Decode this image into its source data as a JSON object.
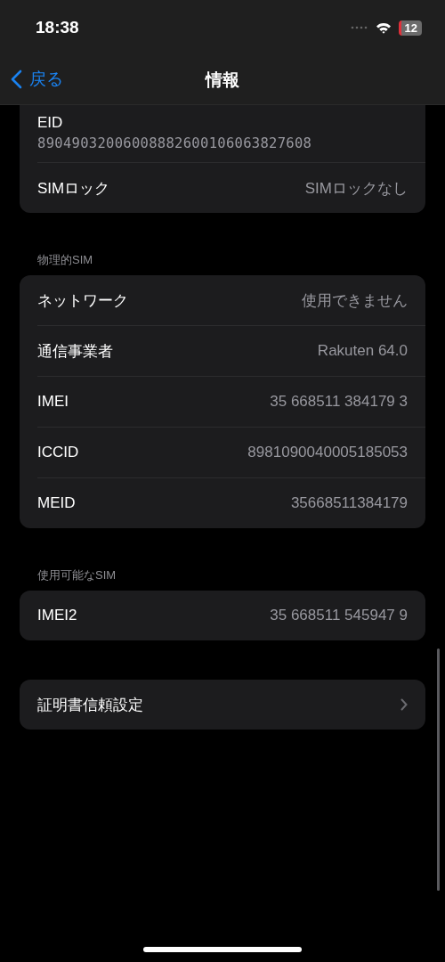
{
  "status_bar": {
    "time": "18:38",
    "battery": "12"
  },
  "nav": {
    "back": "戻る",
    "title": "情報"
  },
  "sections": [
    {
      "rows": [
        {
          "kind": "stacked",
          "label": "EID",
          "value": "89049032006008882600106063827608"
        },
        {
          "kind": "value",
          "label": "SIMロック",
          "value": "SIMロックなし"
        }
      ]
    },
    {
      "header": "物理的SIM",
      "rows": [
        {
          "kind": "value",
          "label": "ネットワーク",
          "value": "使用できません"
        },
        {
          "kind": "value",
          "label": "通信事業者",
          "value": "Rakuten 64.0"
        },
        {
          "kind": "value",
          "label": "IMEI",
          "value": "35 668511 384179 3"
        },
        {
          "kind": "value",
          "label": "ICCID",
          "value": "8981090040005185053"
        },
        {
          "kind": "value",
          "label": "MEID",
          "value": "35668511384179"
        }
      ]
    },
    {
      "header": "使用可能なSIM",
      "rows": [
        {
          "kind": "value",
          "label": "IMEI2",
          "value": "35 668511 545947 9"
        }
      ]
    },
    {
      "rows": [
        {
          "kind": "link",
          "label": "証明書信頼設定"
        }
      ]
    }
  ]
}
